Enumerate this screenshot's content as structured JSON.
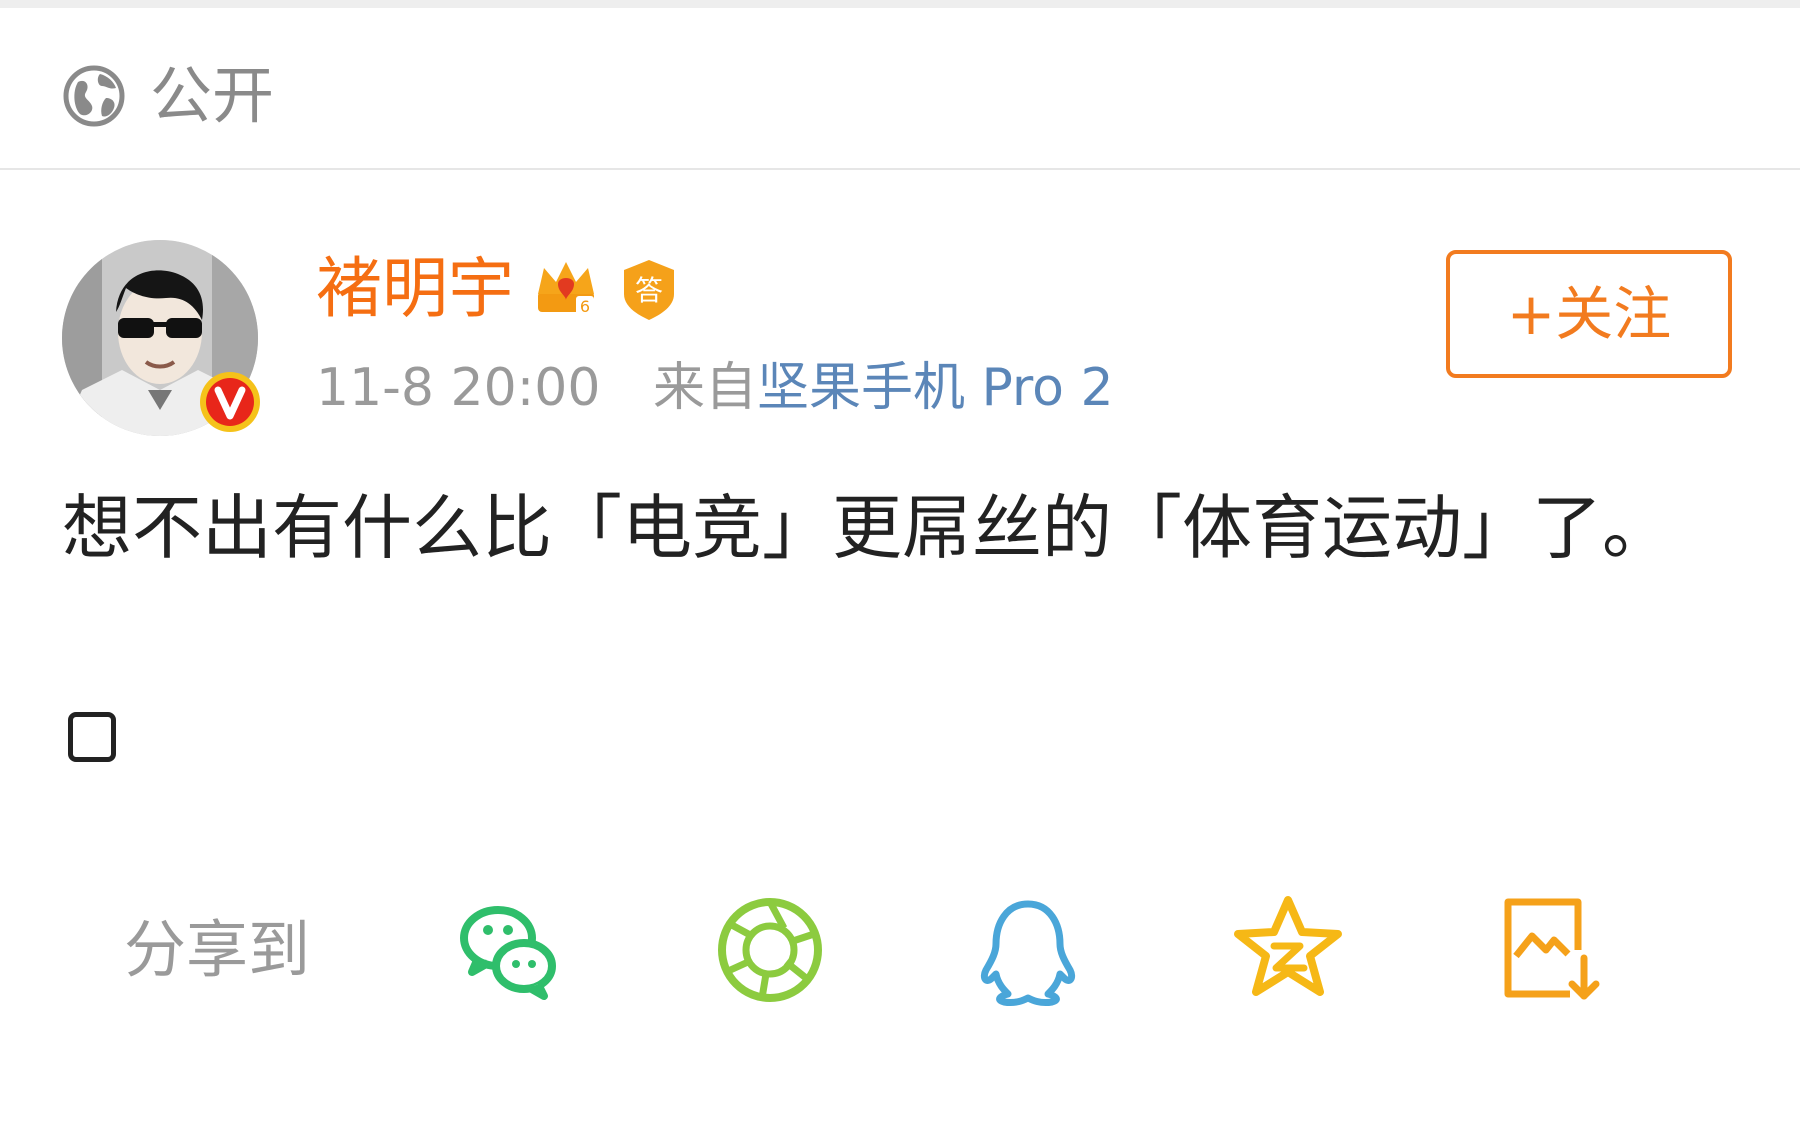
{
  "visibility": {
    "icon": "globe-icon",
    "label": "公开"
  },
  "post": {
    "author": {
      "name": "褚明宇",
      "badges": [
        "crown-level-icon",
        "answer-badge-icon"
      ],
      "verified": true
    },
    "time": "11-8 20:00",
    "from_label": "来自",
    "device": "坚果手机 Pro 2",
    "follow_label": "+关注",
    "text": "想不出有什么比「电竞」更屌丝的「体育运动」了。"
  },
  "share": {
    "label": "分享到",
    "targets": [
      {
        "name": "wechat-icon",
        "color": "#2fbe6b"
      },
      {
        "name": "moments-icon",
        "color": "#8ccb3f"
      },
      {
        "name": "qq-icon",
        "color": "#4aa6d9"
      },
      {
        "name": "qzone-icon",
        "color": "#f6b816"
      },
      {
        "name": "save-image-icon",
        "color": "#f5a11a"
      }
    ]
  },
  "colors": {
    "username": "#f56e12",
    "device": "#5b86b8",
    "follow": "#f27b1f",
    "muted": "#9a9a9a"
  }
}
